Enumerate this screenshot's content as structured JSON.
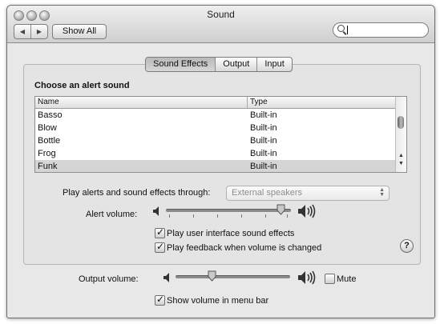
{
  "window": {
    "title": "Sound"
  },
  "toolbar": {
    "back_icon": "left-arrow",
    "forward_icon": "right-arrow",
    "show_all_label": "Show All",
    "search_value": ""
  },
  "tabs": [
    {
      "label": "Sound Effects",
      "selected": true
    },
    {
      "label": "Output",
      "selected": false
    },
    {
      "label": "Input",
      "selected": false
    }
  ],
  "sound_effects": {
    "heading": "Choose an alert sound",
    "columns": [
      "Name",
      "Type"
    ],
    "rows": [
      {
        "name": "Basso",
        "type": "Built-in"
      },
      {
        "name": "Blow",
        "type": "Built-in"
      },
      {
        "name": "Bottle",
        "type": "Built-in"
      },
      {
        "name": "Frog",
        "type": "Built-in"
      },
      {
        "name": "Funk",
        "type": "Built-in",
        "selected": true
      }
    ],
    "play_through_label": "Play alerts and sound effects through:",
    "play_through_value": "External speakers",
    "alert_volume_label": "Alert volume:",
    "alert_volume_level": 0.95,
    "ui_sounds_label": "Play user interface sound effects",
    "ui_sounds_checked": true,
    "feedback_label": "Play feedback when volume is changed",
    "feedback_checked": true,
    "help_label": "?"
  },
  "output": {
    "output_volume_label": "Output volume:",
    "output_volume_level": 0.3,
    "mute_label": "Mute",
    "mute_checked": false,
    "menu_bar_label": "Show volume in menu bar",
    "menu_bar_checked": true
  }
}
